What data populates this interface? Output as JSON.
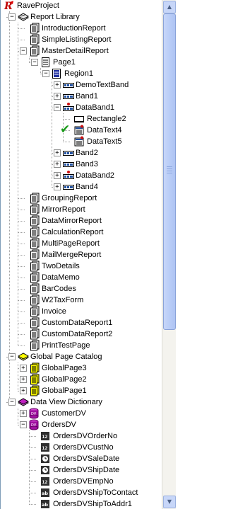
{
  "tree": {
    "rows": [
      {
        "level": 0,
        "expander": null,
        "icon": "rave-project-icon",
        "label": "RaveProject"
      },
      {
        "level": 0,
        "expander": "minus",
        "icon": "report-library-icon",
        "label": "Report Library"
      },
      {
        "level": 1,
        "expander": null,
        "icon": "report-icon",
        "label": "IntroductionReport"
      },
      {
        "level": 1,
        "expander": null,
        "icon": "report-icon",
        "label": "SimpleListingReport"
      },
      {
        "level": 1,
        "expander": "minus",
        "icon": "report-icon",
        "label": "MasterDetailReport"
      },
      {
        "level": 2,
        "expander": "minus",
        "icon": "page-icon",
        "label": "Page1"
      },
      {
        "level": 3,
        "expander": "minus",
        "icon": "region-icon",
        "label": "Region1"
      },
      {
        "level": 4,
        "expander": "plus",
        "icon": "band-icon",
        "label": "DemoTextBand"
      },
      {
        "level": 4,
        "expander": "plus",
        "icon": "band-icon",
        "label": "Band1"
      },
      {
        "level": 4,
        "expander": "minus",
        "icon": "databand-icon",
        "label": "DataBand1"
      },
      {
        "level": 5,
        "expander": null,
        "icon": "rectangle-icon",
        "label": "Rectangle2"
      },
      {
        "level": 5,
        "expander": null,
        "icon": "datatext-icon",
        "label": "DataText4",
        "checked": true
      },
      {
        "level": 5,
        "expander": null,
        "icon": "datatext-icon",
        "label": "DataText5"
      },
      {
        "level": 4,
        "expander": "plus",
        "icon": "band-icon",
        "label": "Band2"
      },
      {
        "level": 4,
        "expander": "plus",
        "icon": "band-icon",
        "label": "Band3"
      },
      {
        "level": 4,
        "expander": "plus",
        "icon": "databand-icon",
        "label": "DataBand2"
      },
      {
        "level": 4,
        "expander": "plus",
        "icon": "band-icon",
        "label": "Band4"
      },
      {
        "level": 1,
        "expander": null,
        "icon": "report-icon",
        "label": "GroupingReport"
      },
      {
        "level": 1,
        "expander": null,
        "icon": "report-icon",
        "label": "MirrorReport"
      },
      {
        "level": 1,
        "expander": null,
        "icon": "report-icon",
        "label": "DataMirrorReport"
      },
      {
        "level": 1,
        "expander": null,
        "icon": "report-icon",
        "label": "CalculationReport"
      },
      {
        "level": 1,
        "expander": null,
        "icon": "report-icon",
        "label": "MultiPageReport"
      },
      {
        "level": 1,
        "expander": null,
        "icon": "report-icon",
        "label": "MailMergeReport"
      },
      {
        "level": 1,
        "expander": null,
        "icon": "report-icon",
        "label": "TwoDetails"
      },
      {
        "level": 1,
        "expander": null,
        "icon": "report-icon",
        "label": "DataMemo"
      },
      {
        "level": 1,
        "expander": null,
        "icon": "report-icon",
        "label": "BarCodes"
      },
      {
        "level": 1,
        "expander": null,
        "icon": "report-icon",
        "label": "W2TaxForm"
      },
      {
        "level": 1,
        "expander": null,
        "icon": "report-icon",
        "label": "Invoice"
      },
      {
        "level": 1,
        "expander": null,
        "icon": "report-icon",
        "label": "CustomDataReport1"
      },
      {
        "level": 1,
        "expander": null,
        "icon": "report-icon",
        "label": "CustomDataReport2"
      },
      {
        "level": 1,
        "expander": null,
        "icon": "report-icon",
        "label": "PrintTestPage"
      },
      {
        "level": 0,
        "expander": "minus",
        "icon": "global-catalog-icon",
        "label": "Global Page Catalog"
      },
      {
        "level": 1,
        "expander": "plus",
        "icon": "global-page-icon",
        "label": "GlobalPage3"
      },
      {
        "level": 1,
        "expander": "plus",
        "icon": "global-page-icon",
        "label": "GlobalPage2"
      },
      {
        "level": 1,
        "expander": "plus",
        "icon": "global-page-icon",
        "label": "GlobalPage1"
      },
      {
        "level": 0,
        "expander": "minus",
        "icon": "data-dictionary-icon",
        "label": "Data View Dictionary"
      },
      {
        "level": 1,
        "expander": "plus",
        "icon": "dataview-icon",
        "label": "CustomerDV"
      },
      {
        "level": 1,
        "expander": "minus",
        "icon": "dataview-icon",
        "label": "OrdersDV"
      },
      {
        "level": 2,
        "expander": null,
        "icon": "field-number-icon",
        "label": "OrdersDVOrderNo"
      },
      {
        "level": 2,
        "expander": null,
        "icon": "field-number-icon",
        "label": "OrdersDVCustNo"
      },
      {
        "level": 2,
        "expander": null,
        "icon": "field-date-icon",
        "label": "OrdersDVSaleDate"
      },
      {
        "level": 2,
        "expander": null,
        "icon": "field-date-icon",
        "label": "OrdersDVShipDate"
      },
      {
        "level": 2,
        "expander": null,
        "icon": "field-number-icon",
        "label": "OrdersDVEmpNo"
      },
      {
        "level": 2,
        "expander": null,
        "icon": "field-text-icon",
        "label": "OrdersDVShipToContact"
      },
      {
        "level": 2,
        "expander": null,
        "icon": "field-text-icon",
        "label": "OrdersDVShipToAddr1"
      }
    ]
  },
  "scrollbar": {
    "up_icon": "scroll-up-arrow-icon",
    "down_icon": "scroll-down-arrow-icon",
    "position": 0.0
  },
  "colors": {
    "check": "#1a9b1a",
    "scroll_thumb": "#b9cdf7",
    "tree_lines": "#a0a0a0"
  }
}
